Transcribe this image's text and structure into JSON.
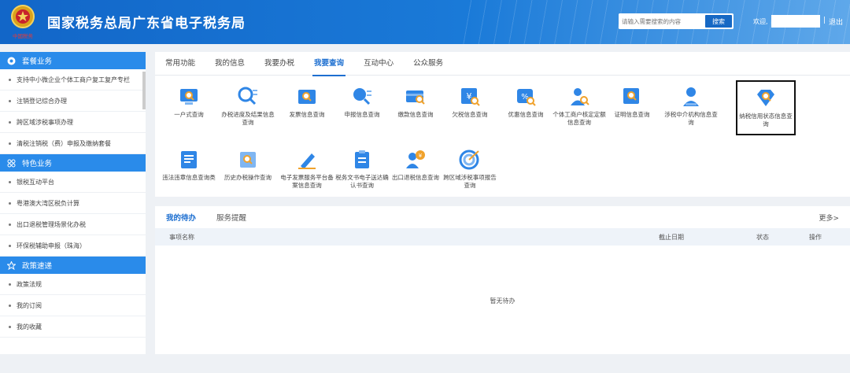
{
  "header": {
    "title": "国家税务总局广东省电子税务局",
    "search_placeholder": "请输入需要搜索的内容",
    "search_button": "搜索",
    "welcome": "欢迎,",
    "separator": "|",
    "logout": "退出",
    "accent": "#1a73d2"
  },
  "sidebar": {
    "sections": [
      {
        "title": "套餐业务",
        "icon": "gear-icon",
        "items": [
          "支持中小微企业个体工商户复工复产专栏",
          "注销登记综合办理",
          "跨区域涉税事项办理",
          "清税注销税（费）申报及缴纳套餐"
        ]
      },
      {
        "title": "特色业务",
        "icon": "grid-icon",
        "items": [
          "银税互动平台",
          "粤港澳大湾区税负计算",
          "出口退税管理场景化办税",
          "环保税辅助申报（珠海）"
        ]
      },
      {
        "title": "政策速递",
        "icon": "star-icon",
        "items": [
          "政策法规",
          "我的订阅",
          "我的收藏"
        ]
      }
    ]
  },
  "tabs": [
    "常用功能",
    "我的信息",
    "我要办税",
    "我要查询",
    "互动中心",
    "公众服务"
  ],
  "active_tab": "我要查询",
  "tiles": [
    {
      "label": "一户式查询",
      "icon": "monitor-search-icon"
    },
    {
      "label": "办税进度及结果信息查询",
      "icon": "progress-search-icon"
    },
    {
      "label": "发票信息查询",
      "icon": "invoice-search-icon"
    },
    {
      "label": "申报信息查询",
      "icon": "declare-search-icon"
    },
    {
      "label": "缴款信息查询",
      "icon": "card-search-icon"
    },
    {
      "label": "欠税信息查询",
      "icon": "yuan-search-icon"
    },
    {
      "label": "优惠信息查询",
      "icon": "discount-search-icon"
    },
    {
      "label": "个体工商户核定定额信息查询",
      "icon": "person-search-icon"
    },
    {
      "label": "证明信息查询",
      "icon": "certificate-search-icon"
    },
    {
      "label": "涉税中介机构信息查询",
      "icon": "agent-search-icon"
    },
    {
      "label": "纳税信用状态信息查询",
      "icon": "diamond-search-icon"
    },
    {
      "label": "违法违章信息查询类",
      "icon": "doc-search-icon"
    },
    {
      "label": "历史办税操作查询",
      "icon": "history-search-icon"
    },
    {
      "label": "电子发票服务平台备案信息查询",
      "icon": "pen-icon"
    },
    {
      "label": "税务文书电子送达确认书查询",
      "icon": "clipboard-icon"
    },
    {
      "label": "出口退税信息查询",
      "icon": "user-yuan-icon"
    },
    {
      "label": "跨区域涉税事项报告查询",
      "icon": "target-icon"
    }
  ],
  "highlighted_tile": "纳税信用状态信息查询",
  "todo": {
    "tabs": [
      "我的待办",
      "服务提醒"
    ],
    "more": "更多>",
    "columns": [
      "事项名称",
      "截止日期",
      "状态",
      "操作"
    ],
    "empty_text": "暂无待办"
  }
}
